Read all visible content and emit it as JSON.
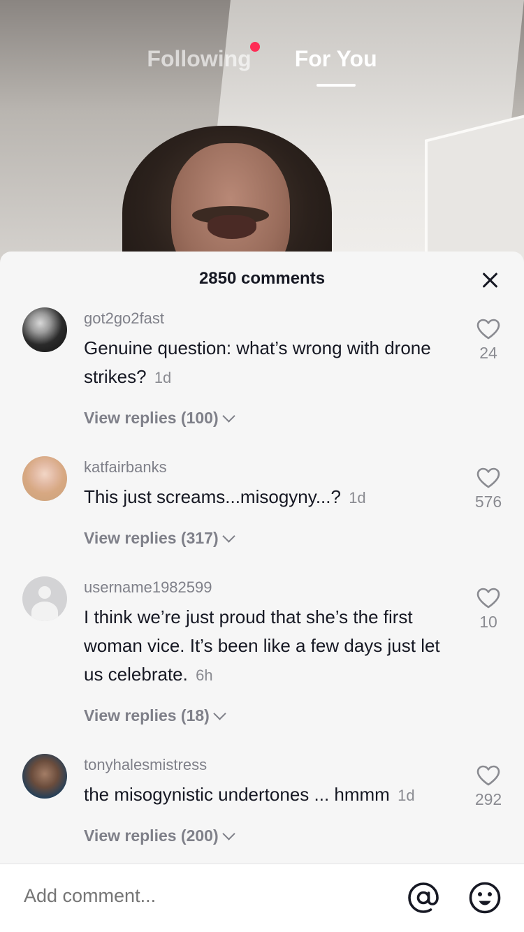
{
  "top_tabs": {
    "following": "Following",
    "for_you": "For You"
  },
  "sheet": {
    "title": "2850 comments",
    "input_placeholder": "Add comment..."
  },
  "comments": [
    {
      "username": "got2go2fast",
      "text": "Genuine question: what’s wrong with drone strikes?",
      "time": "1d",
      "likes": "24",
      "replies": "View replies (100)"
    },
    {
      "username": "katfairbanks",
      "text": "This just screams...misogyny...?",
      "time": "1d",
      "likes": "576",
      "replies": "View replies (317)"
    },
    {
      "username": "username1982599",
      "text": "I think we’re just proud that she’s the first woman vice. It’s been like a few days just let us celebrate.",
      "time": "6h",
      "likes": "10",
      "replies": "View replies (18)"
    },
    {
      "username": "tonyhalesmistress",
      "text": "the misogynistic undertones ... hmmm",
      "time": "1d",
      "likes": "292",
      "replies": "View replies (200)"
    }
  ],
  "colors": {
    "notification_dot": "#fe2c55",
    "sheet_background": "#f6f6f6",
    "primary_text": "#161823",
    "secondary_text": "#7f8089"
  }
}
